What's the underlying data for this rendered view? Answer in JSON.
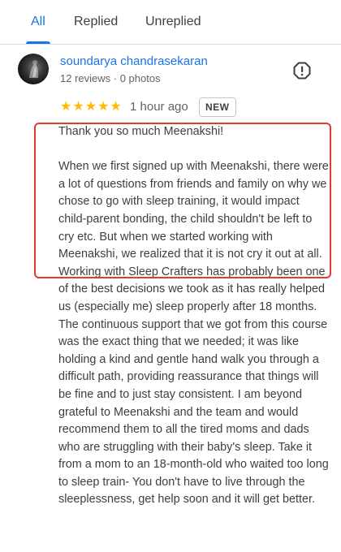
{
  "tabs": [
    {
      "label": "All",
      "active": true
    },
    {
      "label": "Replied",
      "active": false
    },
    {
      "label": "Unreplied",
      "active": false
    }
  ],
  "review": {
    "reviewer_name": "soundarya chandrasekaran",
    "reviewer_meta": "12 reviews · 0 photos",
    "stars": "★★★★★",
    "rating": 5,
    "time": "1 hour ago",
    "badge": "NEW",
    "text": "Thank you so much Meenakshi!\n\nWhen we first signed up with Meenakshi, there were a lot of questions from friends and family on why we chose to go with sleep training, it would impact child-parent bonding, the child shouldn't be left to cry etc. But when we started working with Meenakshi, we realized that it is not cry it out at all. Working with Sleep Crafters has probably been one of the best decisions we took as it has really helped us (especially me) sleep properly after 18 months. The continuous support that we got from this course was the exact thing that we needed; it was like holding a kind and gentle hand walk you through a difficult path, providing reassurance that things will be fine and to just stay consistent. I am beyond grateful to Meenakshi and the team and would recommend them to all the tired moms and dads who are struggling with their baby's sleep. Take it from a mom to an 18-month-old who waited too long to sleep train- You don't have to live through the sleeplessness, get help soon and it will get better."
  },
  "icons": {
    "report": "report-exclamation-icon",
    "avatar": "user-avatar"
  },
  "colors": {
    "accent": "#1a73e8",
    "star": "#fbbc04",
    "highlight": "#e53935"
  }
}
